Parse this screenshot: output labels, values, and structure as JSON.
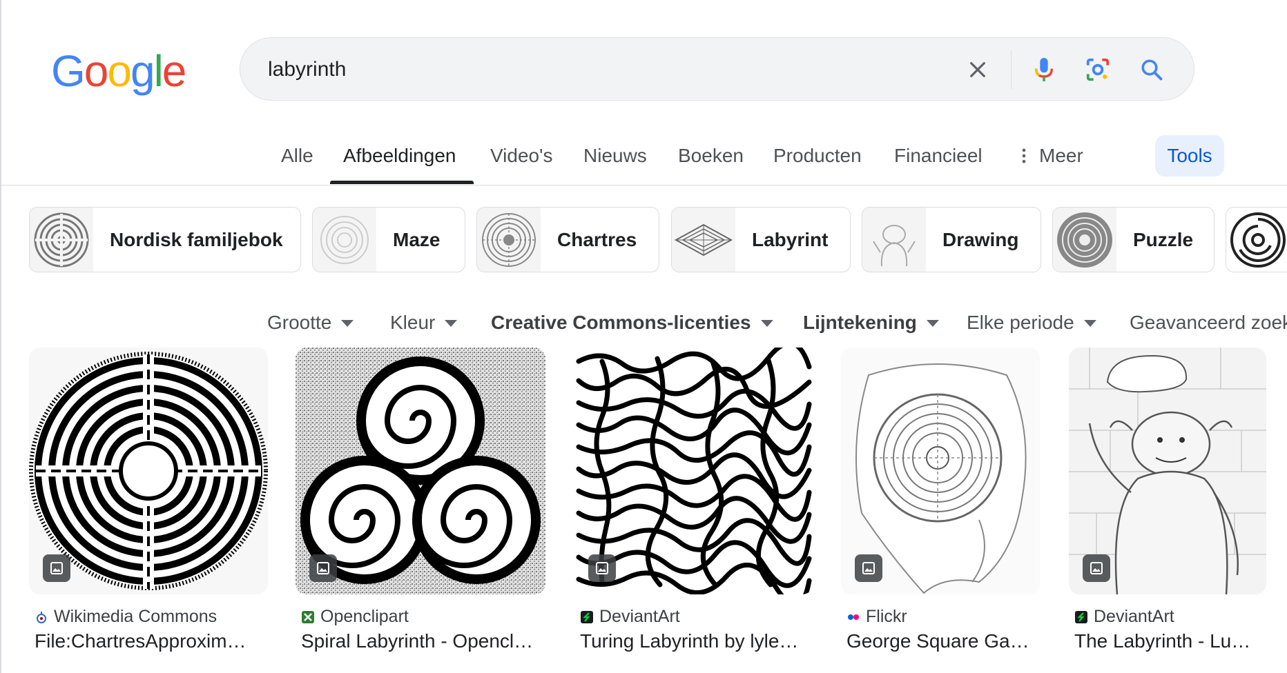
{
  "logo": {
    "text": [
      "G",
      "o",
      "o",
      "g",
      "l",
      "e"
    ],
    "colors": [
      "#4285F4",
      "#EA4335",
      "#FBBC05",
      "#4285F4",
      "#34A853",
      "#EA4335"
    ]
  },
  "search": {
    "value": "labyrinth",
    "clear_icon": "close-icon",
    "mic_icon": "microphone-icon",
    "lens_icon": "lens-icon",
    "search_icon": "search-icon"
  },
  "tabs": [
    {
      "label": "Alle"
    },
    {
      "label": "Afbeeldingen",
      "active": true
    },
    {
      "label": "Video's"
    },
    {
      "label": "Nieuws"
    },
    {
      "label": "Boeken"
    },
    {
      "label": "Producten"
    },
    {
      "label": "Financieel"
    },
    {
      "label": "Meer"
    }
  ],
  "tools_label": "Tools",
  "chips": [
    {
      "label": "Nordisk familjebok"
    },
    {
      "label": "Maze"
    },
    {
      "label": "Chartres"
    },
    {
      "label": "Labyrint"
    },
    {
      "label": "Drawing"
    },
    {
      "label": "Puzzle"
    }
  ],
  "filters": [
    {
      "label": "Grootte"
    },
    {
      "label": "Kleur"
    },
    {
      "label": "Creative Commons-licenties",
      "bold": true
    },
    {
      "label": "Lijntekening",
      "bold": true
    },
    {
      "label": "Elke periode"
    },
    {
      "label": "Geavanceerd zoeken"
    }
  ],
  "results": [
    {
      "source": "Wikimedia Commons",
      "title": "File:ChartresApproxim…"
    },
    {
      "source": "Openclipart",
      "title": "Spiral Labyrinth - Opencl…"
    },
    {
      "source": "DeviantArt",
      "title": "Turing Labyrinth by lyle…"
    },
    {
      "source": "Flickr",
      "title": "George Square Ga…"
    },
    {
      "source": "DeviantArt",
      "title": "The Labyrinth - Lu…"
    }
  ],
  "colors": {
    "accent": "#0b57d0",
    "tools_bg": "#e8f0fe"
  }
}
